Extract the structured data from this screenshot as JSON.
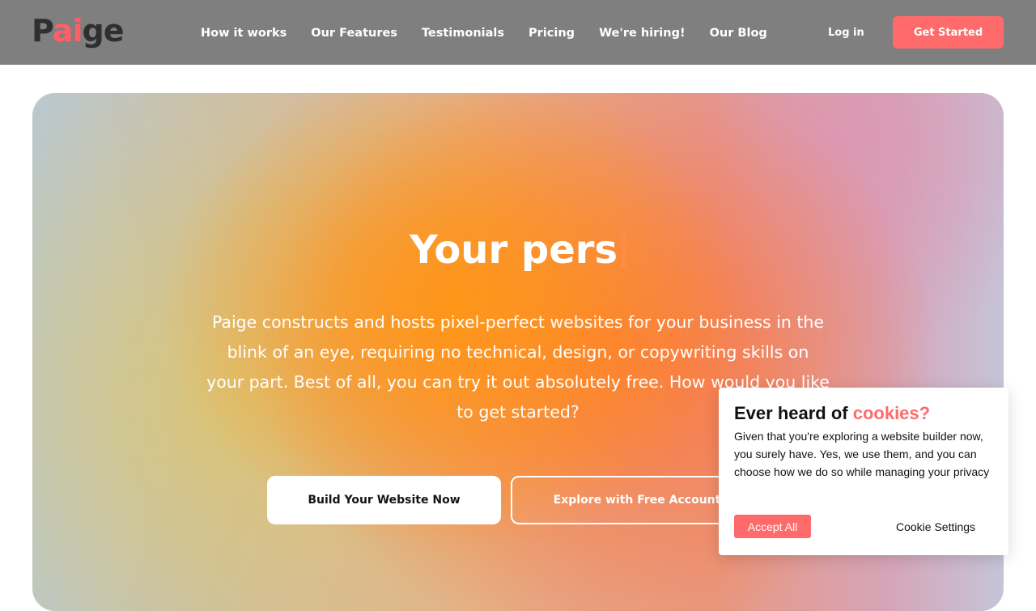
{
  "header": {
    "logo": {
      "part1": "P",
      "part2": "ai",
      "part3": "ge"
    },
    "nav": [
      {
        "label": "How it works"
      },
      {
        "label": "Our Features"
      },
      {
        "label": "Testimonials"
      },
      {
        "label": "Pricing"
      },
      {
        "label": "We're hiring!"
      },
      {
        "label": "Our Blog"
      }
    ],
    "login_label": "Log in",
    "cta_label": "Get Started"
  },
  "hero": {
    "title": "Your pers",
    "description": "Paige constructs and hosts pixel-perfect websites for your business in the blink of an eye, requiring no technical, design, or copywriting skills on your part. Best of all, you can try it out absolutely free. How would you like to get started?",
    "primary_button": "Build Your Website Now",
    "secondary_button": "Explore with Free Account"
  },
  "cookie": {
    "title_prefix": "Ever heard of ",
    "title_accent": "cookies?",
    "text": "Given that you're exploring a website builder now, you surely have. Yes, we use them, and you can choose how we do so while managing your privacy",
    "accept_label": "Accept All",
    "settings_label": "Cookie Settings"
  },
  "colors": {
    "header_bg": "#7f7f7f",
    "accent": "#ff6a6a",
    "logo_dark": "#2f2f2f"
  }
}
